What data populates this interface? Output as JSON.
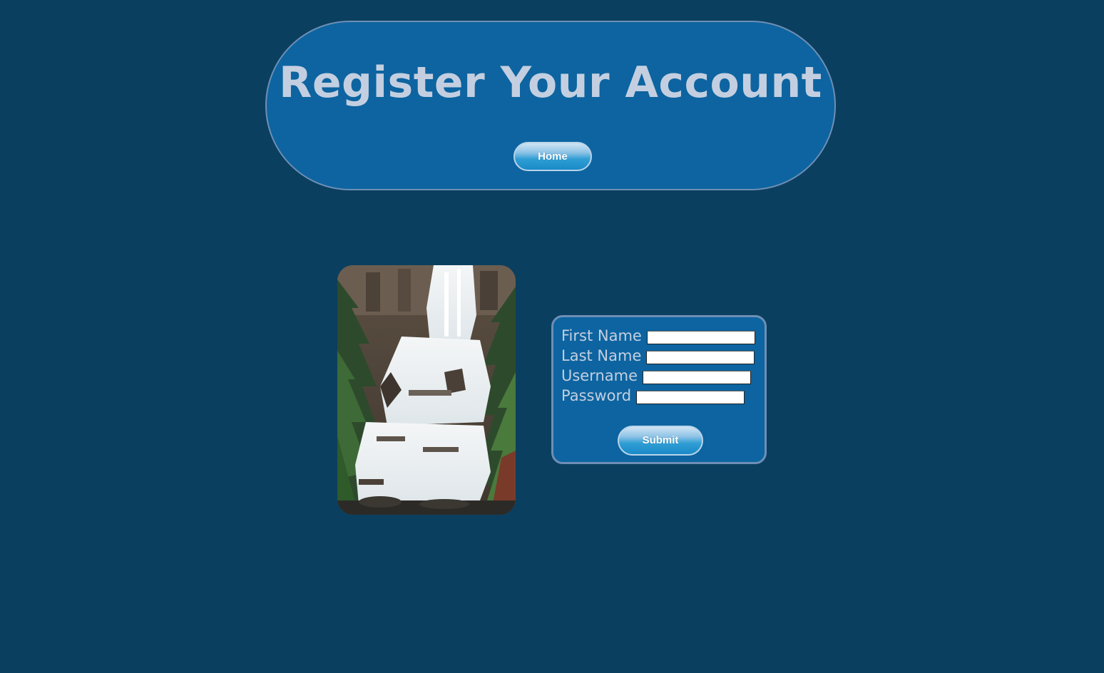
{
  "header": {
    "title": "Register Your Account",
    "home_label": "Home"
  },
  "form": {
    "fields": [
      {
        "label": "First Name",
        "value": ""
      },
      {
        "label": "Last Name",
        "value": ""
      },
      {
        "label": "Username",
        "value": ""
      },
      {
        "label": "Password",
        "value": ""
      }
    ],
    "submit_label": "Submit"
  },
  "colors": {
    "page_background": "#0b3f5f",
    "panel_background": "#0d64a0",
    "panel_border": "#6e8fb5",
    "text": "#c3cfe0"
  },
  "image": {
    "subject": "waterfall"
  }
}
